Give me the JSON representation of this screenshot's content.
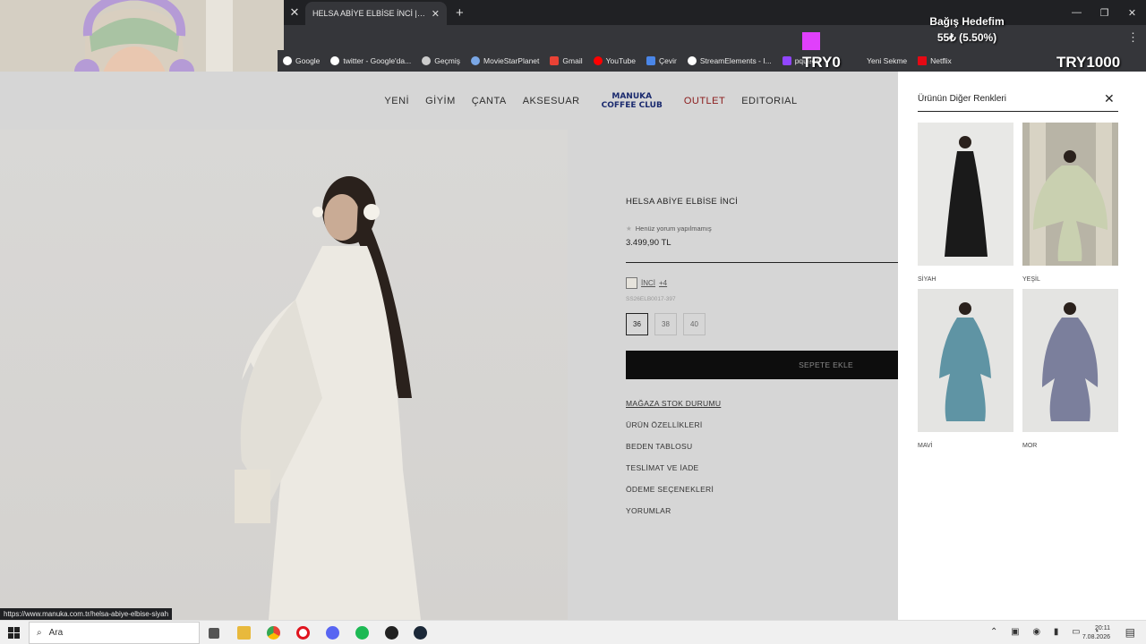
{
  "browser": {
    "tab_title": "HELSA ABİYE ELBİSE İNCİ | Mar",
    "bookmarks": [
      "Google",
      "twitter - Google'da...",
      "Geçmiş",
      "MovieStarPlanet",
      "Gmail",
      "YouTube",
      "Çevir",
      "StreamElements - I...",
      "pqueen",
      "Yeni Sekme",
      "Netflix"
    ],
    "status_url": "https://www.manuka.com.tr/helsa-abiye-elbise-siyah"
  },
  "overlay": {
    "title": "Bağış Hedefim",
    "value": "55₺ (5.50%)",
    "min": "TRY0",
    "max": "TRY1000",
    "progress_percent": 5.5,
    "accent": "#e040fb"
  },
  "nav": {
    "items": [
      "YENİ",
      "GİYİM",
      "ÇANTA",
      "AKSESUAR"
    ],
    "logo_line1": "MANUKA",
    "logo_line2": "COFFEE CLUB",
    "outlet": "OUTLET",
    "editorial": "EDITORIAL"
  },
  "product": {
    "name": "HELSA ABİYE ELBİSE İNCİ",
    "review": "Henüz yorum yapılmamış",
    "price": "3.499,90 TL",
    "color": "İNCİ",
    "color_more": "+4",
    "sku": "SS26ELB0017-397",
    "sizes": [
      "36",
      "38",
      "40"
    ],
    "add_to_cart": "SEPETE EKLE",
    "links": [
      "MAĞAZA STOK DURUMU",
      "ÜRÜN ÖZELLİKLERİ",
      "BEDEN TABLOSU",
      "TESLİMAT VE İADE",
      "ÖDEME SEÇENEKLERİ",
      "YORUMLAR"
    ]
  },
  "panel": {
    "title": "Ürünün Diğer Renkleri",
    "colors": [
      {
        "label": "SİYAH",
        "dress": "#1a1a1a",
        "bg": "#e8e8e6"
      },
      {
        "label": "YEŞİL",
        "dress": "#c9d0b0",
        "bg": "#b8b4a6"
      },
      {
        "label": "MAVİ",
        "dress": "#5f94a4",
        "bg": "#e4e4e2"
      },
      {
        "label": "MOR",
        "dress": "#7b7f9c",
        "bg": "#e4e4e2"
      }
    ]
  },
  "taskbar": {
    "search_placeholder": "Ara",
    "time": "20:11",
    "date": "7.08.2026"
  }
}
